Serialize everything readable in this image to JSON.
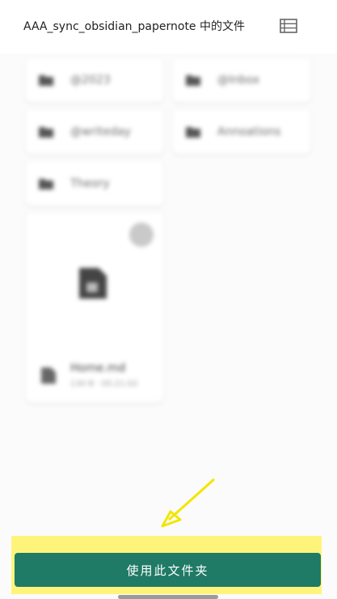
{
  "header": {
    "title": "AAA_sync_obsidian_papernote 中的文件",
    "view_toggle_icon": "list-view-icon"
  },
  "folders": [
    {
      "label": "@2023"
    },
    {
      "label": "@Inbox"
    },
    {
      "label": "@writeday"
    },
    {
      "label": "Annoations"
    },
    {
      "label": "Theory"
    }
  ],
  "file": {
    "name": "Home.md",
    "meta": "130 B · 05:21:02"
  },
  "action": {
    "use_folder_label": "使用此文件夹"
  },
  "colors": {
    "primary": "#1f7a66",
    "highlight": "#fff47a",
    "arrow": "#f2e600"
  }
}
